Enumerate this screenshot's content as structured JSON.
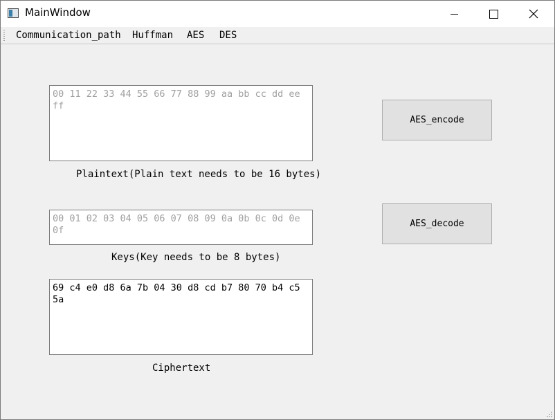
{
  "window": {
    "title": "MainWindow"
  },
  "menubar": {
    "items": [
      "Communication_path",
      "Huffman",
      "AES",
      "DES"
    ]
  },
  "plaintext": {
    "value": "00 11 22 33 44 55 66 77 88 99 aa bb cc dd ee ff",
    "label": "Plaintext(Plain text needs to be 16 bytes)"
  },
  "keys": {
    "value": "00 01 02 03 04 05 06 07 08 09 0a 0b 0c 0d 0e 0f",
    "label": "Keys(Key needs to be 8 bytes)"
  },
  "ciphertext": {
    "value": "69 c4 e0 d8 6a 7b 04 30 d8 cd b7 80 70 b4 c5 5a",
    "label": "Ciphertext"
  },
  "buttons": {
    "encode": "AES_encode",
    "decode": "AES_decode"
  }
}
